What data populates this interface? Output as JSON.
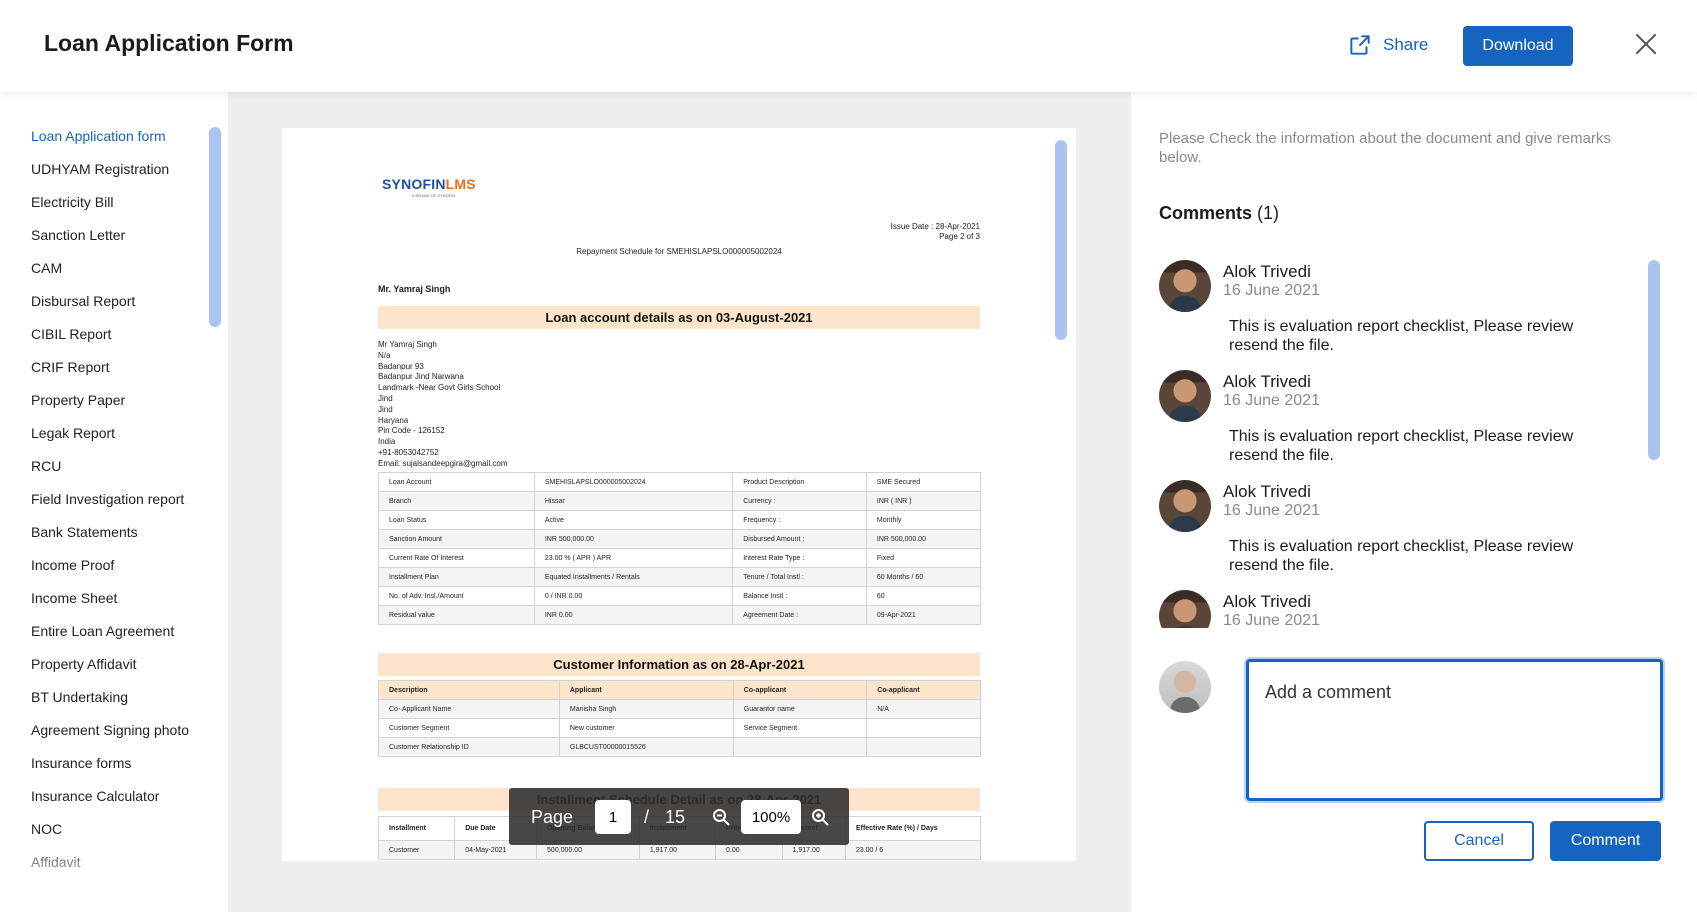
{
  "header": {
    "title": "Loan Application Form",
    "share_label": "Share",
    "download_label": "Download"
  },
  "sidebar": {
    "items": [
      "Loan Application form",
      "UDHYAM Registration",
      "Electricity Bill",
      "Sanction Letter",
      "CAM",
      "Disbursal Report",
      "CIBIL Report",
      "CRIF Report",
      "Property Paper",
      "Legak Report",
      "RCU",
      "Field  Investigation report",
      "Bank Statements",
      "Income Proof",
      "Income Sheet",
      "Entire Loan Agreement",
      "Property Affidavit",
      "BT Undertaking",
      "Agreement Signing photo",
      "Insurance forms",
      "Insurance Calculator",
      "NOC",
      "Affidavit"
    ],
    "active_index": 0
  },
  "document": {
    "logo": "SYNOFIN",
    "logo_suffix": "LMS",
    "logo_sub": "A BRAND OF SYNOFIN",
    "issue_date": "Issue Date : 28-Apr-2021",
    "page_of": "Page 2 of 3",
    "schedule_title": "Repayment Schedule for SMEHISLAPSLO000005002024",
    "customer": "Mr. Yamraj Singh",
    "loan_band": "Loan account details as on 03-August-2021",
    "address": [
      "Mr Yamraj Singh",
      "N/a",
      "Badanpur 93",
      "Badanpur Jind Narwana",
      "Landmark -Near Govt Girls School",
      "Jind",
      "Jind",
      "Haryana",
      "Pin Code - 126152",
      "India",
      "+91-8053042752",
      "Email: sujalsandeepgira@gmail.com"
    ],
    "loan_table": [
      [
        "Loan Account",
        "SMEHISLAPSLO000005002024",
        "Product Description",
        "SME Secured"
      ],
      [
        "Branch",
        "Hissar",
        "Currency :",
        "INR ( INR )"
      ],
      [
        "Loan Status",
        "Active",
        "Frequency :",
        "Monthly"
      ],
      [
        "Sanction Amount",
        "INR 500,000.00",
        "Disbursed Amount :",
        "INR 500,000.00"
      ],
      [
        "Current Rate Of Interest",
        "23.00 % ( APR ) APR",
        "Interest Rate Type :",
        "Fixed"
      ],
      [
        "Installment Plan",
        "Equated Installments / Rentals",
        "Tenure / Total Instl :",
        "60 Months / 60"
      ],
      [
        "No. of Adv. Insl./Amount",
        "0 / INR 0.00",
        "Balance Instl :",
        "60"
      ],
      [
        "Residual value",
        "INR 0.00",
        "Agreement Date :",
        "09-Apr-2021"
      ]
    ],
    "customer_band": "Customer Information as on 28-Apr-2021",
    "customer_table": {
      "headers": [
        "Description",
        "Applicant",
        "Co-applicant",
        "Co-applicant"
      ],
      "rows": [
        [
          "Co- Applicant Name",
          "Manisha Singh",
          "Guarantor name",
          "N/A"
        ],
        [
          "Customer Segment",
          "New customer",
          "Service Segment",
          ""
        ],
        [
          "Customer Relationship ID",
          "GLBCUST00000015526",
          "",
          ""
        ]
      ]
    },
    "installment_band": "Installment Schedule Detail as on 28-Apr-2021",
    "installment_table": {
      "headers": [
        "Installment",
        "Due Date",
        "Opening Balance",
        "Installment",
        "Principal",
        "Interest",
        "Effective Rate (%) / Days"
      ],
      "rows": [
        [
          "Customer",
          "04-May-2021",
          "500,000.00",
          "1,917.00",
          "0.00",
          "1,917.00",
          "23.00 / 6"
        ]
      ]
    }
  },
  "pagebar": {
    "page_label": "Page",
    "current_page": "1",
    "separator": "/",
    "total_pages": "15",
    "zoom": "100%"
  },
  "panel": {
    "intro": "Please Check the information about the document and give remarks below.",
    "comments_title": "Comments",
    "comments_count": "(1)",
    "comments": [
      {
        "name": "Alok Trivedi",
        "date": "16 June 2021",
        "text": "This is evaluation report checklist, Please review resend the file."
      },
      {
        "name": "Alok Trivedi",
        "date": "16 June 2021",
        "text": "This is evaluation report checklist, Please review resend the file."
      },
      {
        "name": "Alok Trivedi",
        "date": "16 June 2021",
        "text": "This is evaluation report checklist, Please review resend the file."
      },
      {
        "name": "Alok Trivedi",
        "date": "16 June 2021",
        "text": ""
      }
    ],
    "comment_placeholder": "Add a comment",
    "cancel_label": "Cancel",
    "comment_label": "Comment"
  },
  "colors": {
    "accent": "#1565c0",
    "scrollbar": "#a9c4ef",
    "band": "#fde5cc",
    "viewer_bg": "#eeeeee"
  },
  "icons": [
    "share-icon",
    "close-icon",
    "zoom-out-icon",
    "zoom-in-icon"
  ]
}
